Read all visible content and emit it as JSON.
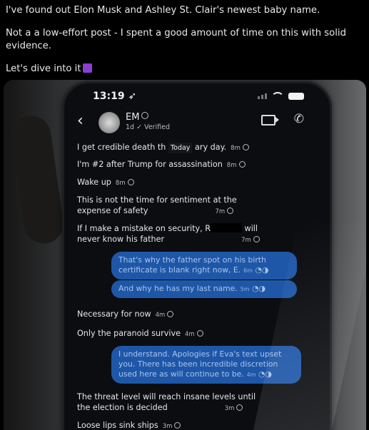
{
  "post": {
    "line1": "I've found out Elon Musk and Ashley St. Clair's newest baby name.",
    "line2": "Not a a low-effort post - I spent a good amount of time on this with solid evidence.",
    "line3": "Let's dive into it"
  },
  "phone": {
    "time": "13:19",
    "contact_name": "EM",
    "contact_sub": "1d ✓ Verified",
    "date_chip": "Today"
  },
  "messages": [
    {
      "pre": "I get credible death th",
      "post": "ary day.",
      "time": "8m"
    },
    {
      "text": "I'm #2 after Trump for assassination",
      "time": "8m"
    },
    {
      "text": "Wake up",
      "time": "8m"
    },
    {
      "line1": "This is not the time for sentiment at the",
      "line2": "expense of safety",
      "time": "7m"
    },
    {
      "pre": "If I make a mistake on security, R",
      "post": "will",
      "line2": "never know his father",
      "time": "7m"
    },
    {
      "line1": "That's why the father spot on his birth",
      "line2": "certificate is blank right now, E.",
      "time": "6m"
    },
    {
      "text": "And why he has my last name.",
      "time": "5m"
    },
    {
      "text": "Necessary for now",
      "time": "4m"
    },
    {
      "text": "Only the paranoid survive",
      "time": "4m"
    },
    {
      "line1": "I understand. Apologies if Eva's text upset",
      "line2": "you. There has been incredible discretion",
      "line3": "used here as will continue to be.",
      "time": "4m"
    },
    {
      "line1": "The threat level will reach insane levels until",
      "line2": "the election is decided",
      "time": "3m"
    },
    {
      "text": "Loose lips sink ships",
      "time": "3m"
    }
  ]
}
